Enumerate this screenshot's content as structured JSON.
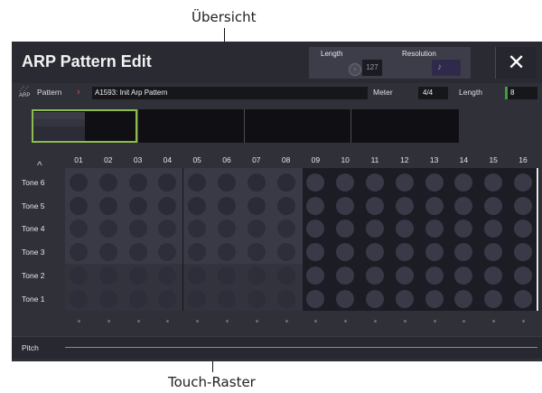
{
  "annotations": {
    "overview": "Übersicht",
    "touch_grid": "Touch-Raster"
  },
  "header": {
    "title": "ARP Pattern Edit",
    "length_label": "Length",
    "length_value": "127",
    "resolution_label": "Resolution",
    "resolution_symbol": "♪",
    "close_symbol": "✕"
  },
  "pattern_row": {
    "icon_text": "ARP",
    "label": "Pattern",
    "chevron": "›",
    "pattern_name": "A1593: Init Arp Pattern",
    "meter_label": "Meter",
    "meter_value": "4/4",
    "length_label": "Length",
    "length_value": "8"
  },
  "grid": {
    "scroll_up_symbol": "^",
    "columns": [
      "01",
      "02",
      "03",
      "04",
      "05",
      "06",
      "07",
      "08",
      "09",
      "10",
      "11",
      "12",
      "13",
      "14",
      "15",
      "16"
    ],
    "tones": [
      "Tone 6",
      "Tone 5",
      "Tone 4",
      "Tone 3",
      "Tone 2",
      "Tone 1"
    ],
    "active_steps": 8,
    "visible_tones": 2
  },
  "pitch": {
    "label": "Pitch"
  },
  "colors": {
    "active_visible_cell": "#2b2b38",
    "active_hidden_cell": "#2e2e3a",
    "inactive_cell": "#393948",
    "overview_selection": "#8dbb4c",
    "length_indicator": "#3e9e3e",
    "chevron": "#e04a4a"
  }
}
